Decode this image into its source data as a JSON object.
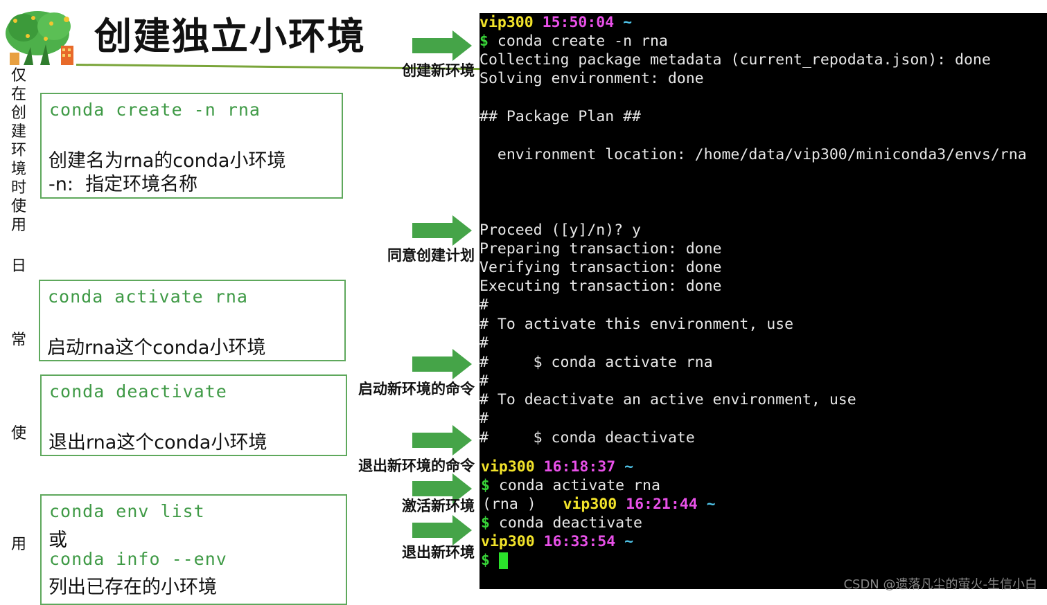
{
  "title": "创建独立小环境",
  "side_label": {
    "chars_top": [
      "仅",
      "在",
      "创",
      "建",
      "环",
      "境",
      "时",
      "使",
      "用"
    ],
    "char_ri": "日",
    "char_chang": "常",
    "char_shi": "使",
    "char_yong": "用"
  },
  "boxes": [
    {
      "code": "conda create -n rna",
      "desc1": "创建名为rna的conda小环境",
      "desc2": "-n:  指定环境名称"
    },
    {
      "code": "conda activate rna",
      "desc1": "启动rna这个conda小环境"
    },
    {
      "code": "conda deactivate",
      "desc1": "退出rna这个conda小环境"
    },
    {
      "code1": "conda env list",
      "or": "或",
      "code2": "conda info --env",
      "desc1": "列出已存在的小环境"
    }
  ],
  "arrows": [
    {
      "label": "创建新环境"
    },
    {
      "label": "同意创建计划"
    },
    {
      "label": "启动新环境的命令"
    },
    {
      "label": "退出新环境的命令"
    },
    {
      "label": "激活新环境"
    },
    {
      "label": "退出新环境"
    }
  ],
  "colors": {
    "accent_green": "#5ea85c",
    "arrow_green": "#45a448",
    "prompt_yellow": "#f2e32a",
    "time_magenta": "#e850e8"
  },
  "terminal": {
    "l1_user": "vip300",
    "l1_time": "15:50:04",
    "l1_tilde": "~",
    "l2_prompt": "$",
    "l2_cmd": " conda create -n rna",
    "l3": "Collecting package metadata (current_repodata.json): done",
    "l4": "Solving environment: done",
    "l5": "## Package Plan ##",
    "l6": "  environment location: /home/data/vip300/miniconda3/envs/rna",
    "l7": "Proceed ([y]/n)? y",
    "l8": "Preparing transaction: done",
    "l9": "Verifying transaction: done",
    "l10": "Executing transaction: done",
    "l11": "#",
    "l12": "# To activate this environment, use",
    "l13": "#",
    "l14": "#     $ conda activate rna",
    "l15": "#",
    "l16": "# To deactivate an active environment, use",
    "l17": "#",
    "l18": "#     $ conda deactivate",
    "l19_user": "vip300",
    "l19_time": "16:18:37",
    "l19_tilde": "~",
    "l20_prompt": "$",
    "l20_cmd": " conda activate rna",
    "l21_env": "(rna )",
    "l21_user": "vip300",
    "l21_time": "16:21:44",
    "l21_tilde": "~",
    "l22_prompt": "$",
    "l22_cmd": " conda deactivate",
    "l23_user": "vip300",
    "l23_time": "16:33:54",
    "l23_tilde": "~",
    "l24_prompt": "$"
  },
  "watermark": "CSDN @遗落凡尘的萤火-生信小白"
}
